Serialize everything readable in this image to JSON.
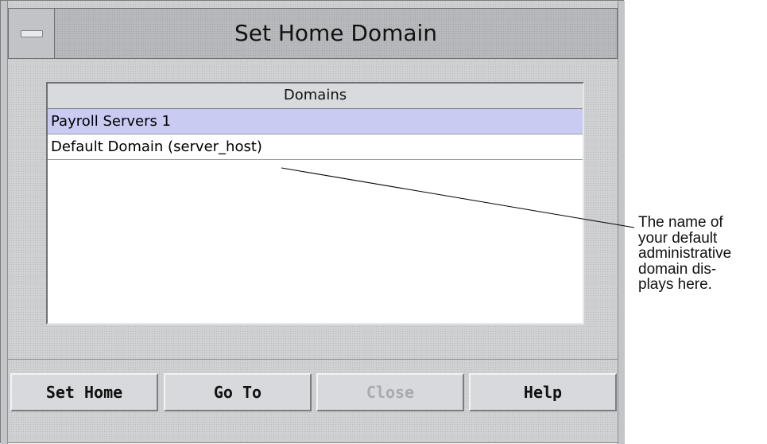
{
  "window": {
    "title": "Set Home Domain"
  },
  "list": {
    "header": "Domains",
    "rows": [
      "Payroll Servers 1",
      "Default Domain (server_host)"
    ]
  },
  "buttons": {
    "set_home": "Set Home",
    "go_to": "Go To",
    "close": "Close",
    "help": "Help"
  },
  "callout": {
    "lines": [
      "The name of",
      "your default",
      "administrative",
      "domain dis-",
      "plays here."
    ]
  },
  "colors": {
    "selected_row": "#c9cbf3",
    "window_bg": "#cfd1d3"
  }
}
